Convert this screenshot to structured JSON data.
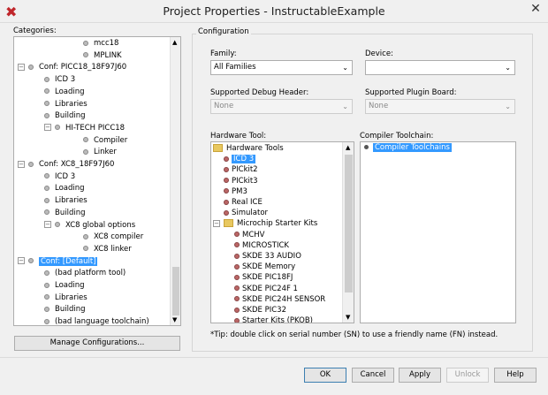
{
  "window": {
    "title": "Project Properties - InstructableExample",
    "close": "✕"
  },
  "categories": {
    "label": "Categories:",
    "items": [
      {
        "text": "mcc18",
        "level": 3
      },
      {
        "text": "MPLINK",
        "level": 3
      },
      {
        "text": "Conf: PICC18_18F97J60",
        "level": 1,
        "expander": "−"
      },
      {
        "text": "ICD 3",
        "level": 2
      },
      {
        "text": "Loading",
        "level": 2
      },
      {
        "text": "Libraries",
        "level": 2
      },
      {
        "text": "Building",
        "level": 2
      },
      {
        "text": "HI-TECH PICC18",
        "level": 2,
        "expander": "−"
      },
      {
        "text": "Compiler",
        "level": 3
      },
      {
        "text": "Linker",
        "level": 3
      },
      {
        "text": "Conf: XC8_18F97J60",
        "level": 1,
        "expander": "−"
      },
      {
        "text": "ICD 3",
        "level": 2
      },
      {
        "text": "Loading",
        "level": 2
      },
      {
        "text": "Libraries",
        "level": 2
      },
      {
        "text": "Building",
        "level": 2
      },
      {
        "text": "XC8 global options",
        "level": 2,
        "expander": "−"
      },
      {
        "text": "XC8 compiler",
        "level": 3
      },
      {
        "text": "XC8 linker",
        "level": 3
      },
      {
        "text": "Conf: [Default]",
        "level": 1,
        "expander": "−",
        "selected": true
      },
      {
        "text": "(bad platform tool)",
        "level": 2
      },
      {
        "text": "Loading",
        "level": 2
      },
      {
        "text": "Libraries",
        "level": 2
      },
      {
        "text": "Building",
        "level": 2
      },
      {
        "text": "(bad language toolchain)",
        "level": 2
      }
    ]
  },
  "manage_button": "Manage Configurations...",
  "configuration": {
    "group_label": "Configuration",
    "family_label": "Family:",
    "family_value": "All Families",
    "device_label": "Device:",
    "device_value": "",
    "debug_header_label": "Supported Debug Header:",
    "debug_header_value": "None",
    "plugin_board_label": "Supported Plugin Board:",
    "plugin_board_value": "None",
    "hardware_tool_label": "Hardware Tool:",
    "hardware_tools": [
      {
        "text": "Hardware Tools",
        "type": "folder",
        "level": 0
      },
      {
        "text": "ICD 3",
        "level": 1,
        "selected": true
      },
      {
        "text": "PICkit2",
        "level": 1
      },
      {
        "text": "PICkit3",
        "level": 1
      },
      {
        "text": "PM3",
        "level": 1
      },
      {
        "text": "Real ICE",
        "level": 1
      },
      {
        "text": "Simulator",
        "level": 1
      },
      {
        "text": "Microchip Starter Kits",
        "type": "folder",
        "level": 1,
        "expander": "−"
      },
      {
        "text": "MCHV",
        "level": 2
      },
      {
        "text": "MICROSTICK",
        "level": 2
      },
      {
        "text": "SKDE 33 AUDIO",
        "level": 2
      },
      {
        "text": "SKDE Memory",
        "level": 2
      },
      {
        "text": "SKDE PIC18FJ",
        "level": 2
      },
      {
        "text": "SKDE PIC24F 1",
        "level": 2
      },
      {
        "text": "SKDE PIC24H SENSOR",
        "level": 2
      },
      {
        "text": "SKDE PIC32",
        "level": 2
      },
      {
        "text": "Starter Kits (PKOB)",
        "level": 2
      }
    ],
    "compiler_toolchain_label": "Compiler Toolchain:",
    "compiler_toolchains": [
      {
        "text": "Compiler Toolchains",
        "selected": true
      }
    ],
    "tip": "*Tip: double click on serial number (SN) to use a friendly name (FN) instead."
  },
  "buttons": {
    "ok": "OK",
    "cancel": "Cancel",
    "apply": "Apply",
    "unlock": "Unlock",
    "help": "Help"
  }
}
